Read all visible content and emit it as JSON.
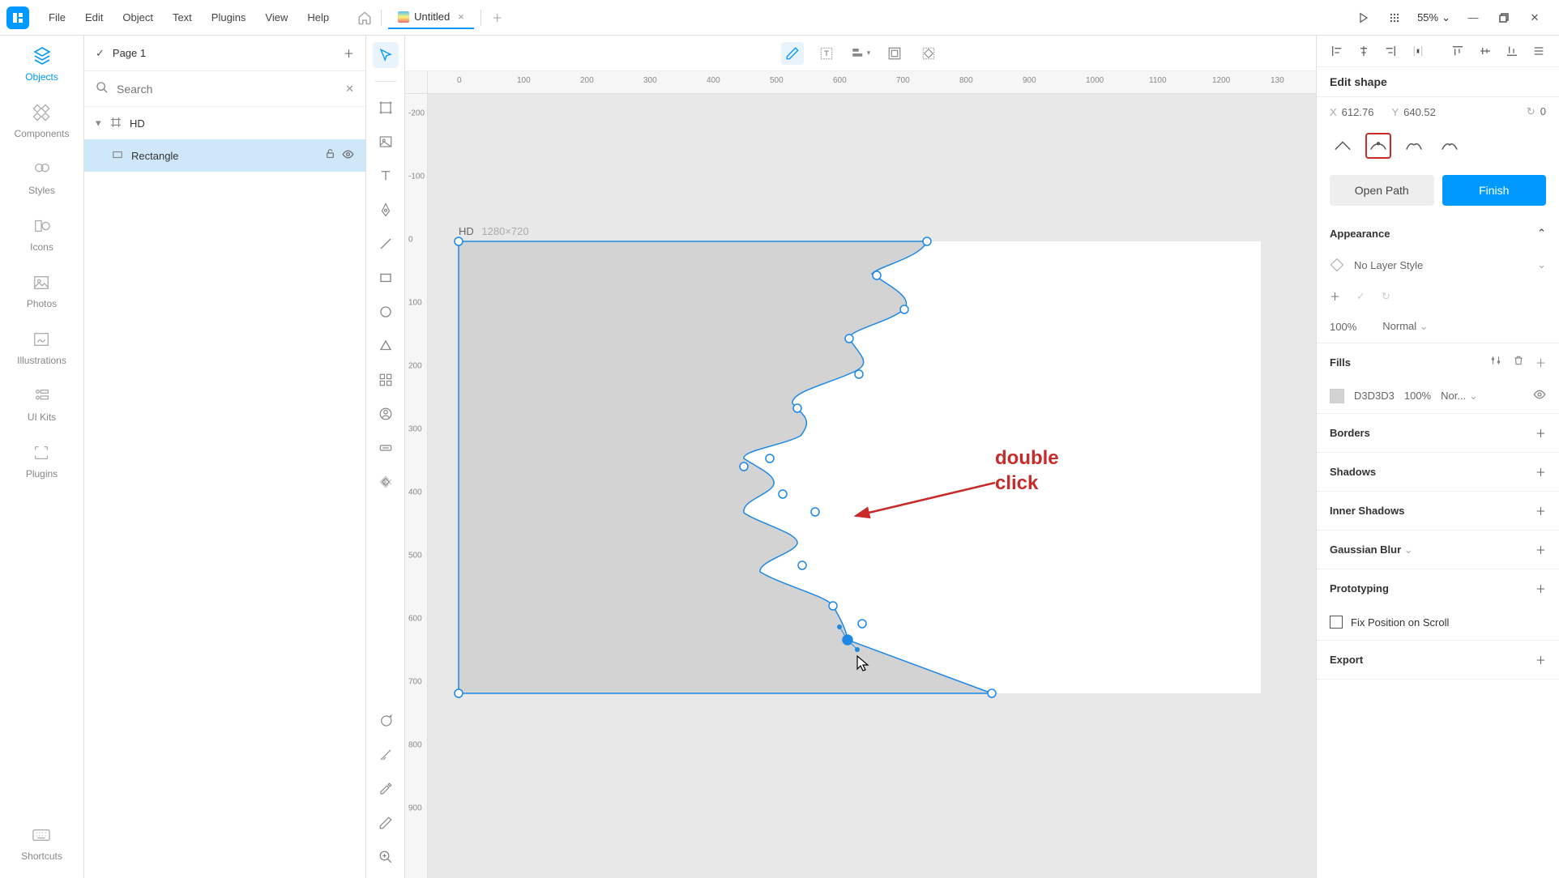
{
  "menu": {
    "items": [
      "File",
      "Edit",
      "Object",
      "Text",
      "Plugins",
      "View",
      "Help"
    ]
  },
  "doc": {
    "title": "Untitled"
  },
  "zoom": "55%",
  "sidebar": {
    "sections": [
      {
        "label": "Objects"
      },
      {
        "label": "Components"
      },
      {
        "label": "Styles"
      },
      {
        "label": "Icons"
      },
      {
        "label": "Photos"
      },
      {
        "label": "Illustrations"
      },
      {
        "label": "UI Kits"
      },
      {
        "label": "Plugins"
      },
      {
        "label": "Shortcuts"
      }
    ]
  },
  "pages": {
    "current": "Page 1"
  },
  "search": {
    "placeholder": "Search"
  },
  "layers": {
    "frame": "HD",
    "item": "Rectangle"
  },
  "artboard": {
    "name": "HD",
    "dims": "1280×720"
  },
  "ruler_h": [
    "0",
    "100",
    "200",
    "300",
    "400",
    "500",
    "600",
    "700",
    "800",
    "900",
    "1000",
    "1100",
    "1200",
    "130"
  ],
  "ruler_v": [
    "-200",
    "-100",
    "0",
    "100",
    "200",
    "300",
    "400",
    "500",
    "600",
    "700",
    "800",
    "900"
  ],
  "annotation": {
    "line1": "double",
    "line2": "click"
  },
  "right": {
    "edit_title": "Edit shape",
    "x_label": "X",
    "x": "612.76",
    "y_label": "Y",
    "y": "640.52",
    "r_label": "⟳",
    "r": "0",
    "open_path": "Open Path",
    "finish": "Finish",
    "appearance": "Appearance",
    "layer_style": "No Layer Style",
    "opacity": "100%",
    "blend": "Normal",
    "fills": "Fills",
    "fill_hex": "D3D3D3",
    "fill_opacity": "100%",
    "fill_mode": "Nor...",
    "borders": "Borders",
    "shadows": "Shadows",
    "inner_shadows": "Inner Shadows",
    "blur": "Gaussian Blur",
    "proto": "Prototyping",
    "fixpos": "Fix Position on Scroll",
    "export": "Export"
  }
}
